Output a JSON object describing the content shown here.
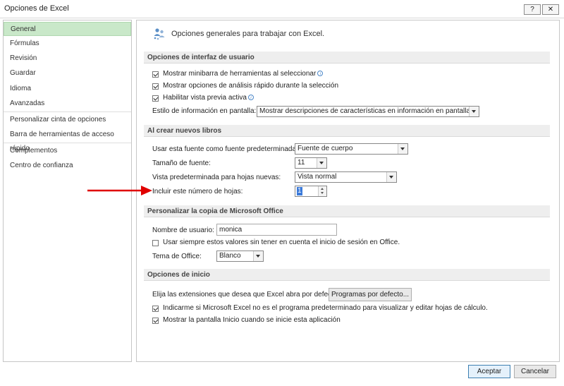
{
  "window": {
    "title": "Opciones de Excel",
    "help_label": "?",
    "close_label": "✕"
  },
  "sidebar": {
    "items": [
      {
        "label": "General"
      },
      {
        "label": "Fórmulas"
      },
      {
        "label": "Revisión"
      },
      {
        "label": "Guardar"
      },
      {
        "label": "Idioma"
      },
      {
        "label": "Avanzadas"
      },
      {
        "label": "Personalizar cinta de opciones"
      },
      {
        "label": "Barra de herramientas de acceso rápido"
      },
      {
        "label": "Complementos"
      },
      {
        "label": "Centro de confianza"
      }
    ],
    "selected": "General"
  },
  "header": {
    "text": "Opciones generales para trabajar con Excel.",
    "icon": "general-options-icon"
  },
  "ui_options": {
    "title": "Opciones de interfaz de usuario",
    "show_minibar": {
      "label": "Mostrar minibarra de herramientas al seleccionar",
      "checked": true
    },
    "show_quick_analysis": {
      "label": "Mostrar opciones de análisis rápido durante la selección",
      "checked": true
    },
    "live_preview": {
      "label": "Habilitar vista previa activa",
      "checked": true
    },
    "screentip_label": "Estilo de información en pantalla:",
    "screentip_value": "Mostrar descripciones de características en información en pantalla",
    "info_glyph": "i"
  },
  "new_workbook": {
    "title": "Al crear nuevos libros",
    "font_label": "Usar esta fuente como fuente predeterminada:",
    "font_value": "Fuente de cuerpo",
    "size_label": "Tamaño de fuente:",
    "size_value": "11",
    "view_label": "Vista predeterminada para hojas nuevas:",
    "view_value": "Vista normal",
    "sheets_label": "Incluir este número de hojas:",
    "sheets_value": "1"
  },
  "personalize": {
    "title": "Personalizar la copia de Microsoft Office",
    "username_label": "Nombre de usuario:",
    "username_value": "monica",
    "always_use": {
      "label": "Usar siempre estos valores sin tener en cuenta el inicio de sesión en Office.",
      "checked": false
    },
    "theme_label": "Tema de Office:",
    "theme_value": "Blanco"
  },
  "startup": {
    "title": "Opciones de inicio",
    "extensions_label": "Elija las extensiones que desea que Excel abra por defecto:",
    "default_programs_button": "Programas por defecto...",
    "tell_default": {
      "label": "Indicarme si Microsoft Excel no es el programa predeterminado para visualizar y editar hojas de cálculo.",
      "checked": true
    },
    "show_start": {
      "label": "Mostrar la pantalla Inicio cuando se inicie esta aplicación",
      "checked": true
    }
  },
  "footer": {
    "ok_label": "Aceptar",
    "cancel_label": "Cancelar"
  },
  "colors": {
    "selected_nav": "#c9e8c9",
    "annotation_arrow": "#e00000",
    "section_bg": "#eeeeee"
  }
}
